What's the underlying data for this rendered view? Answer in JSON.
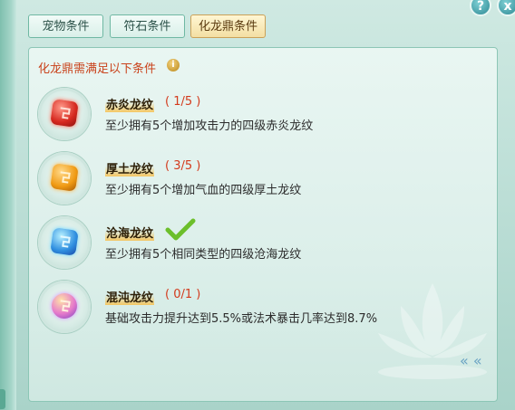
{
  "tabs": [
    {
      "label": "宠物条件",
      "active": false
    },
    {
      "label": "符石条件",
      "active": false
    },
    {
      "label": "化龙鼎条件",
      "active": true
    }
  ],
  "window_buttons": {
    "help": "?",
    "close": "x"
  },
  "panel": {
    "title": "化龙鼎需满足以下条件",
    "info_icon_glyph": "i",
    "items": [
      {
        "name": "赤炎龙纹",
        "progress": "( 1/5 )",
        "desc": "至少拥有5个增加攻击力的四级赤炎龙纹",
        "gem": "red",
        "complete": false
      },
      {
        "name": "厚土龙纹",
        "progress": "( 3/5 )",
        "desc": "至少拥有5个增加气血的四级厚土龙纹",
        "gem": "orange",
        "complete": false
      },
      {
        "name": "沧海龙纹",
        "progress": "",
        "desc": "至少拥有5个相同类型的四级沧海龙纹",
        "gem": "blue",
        "complete": true
      },
      {
        "name": "混沌龙纹",
        "progress": "( 0/1 )",
        "desc": "基础攻击力提升达到5.5%或法术暴击几率达到8.7%",
        "gem": "purple",
        "complete": false
      }
    ],
    "scroll_hint": "« «"
  },
  "colors": {
    "accent_red": "#d33a1c",
    "tab_active": "#f3dfa3",
    "check_green": "#6cbf2b"
  }
}
